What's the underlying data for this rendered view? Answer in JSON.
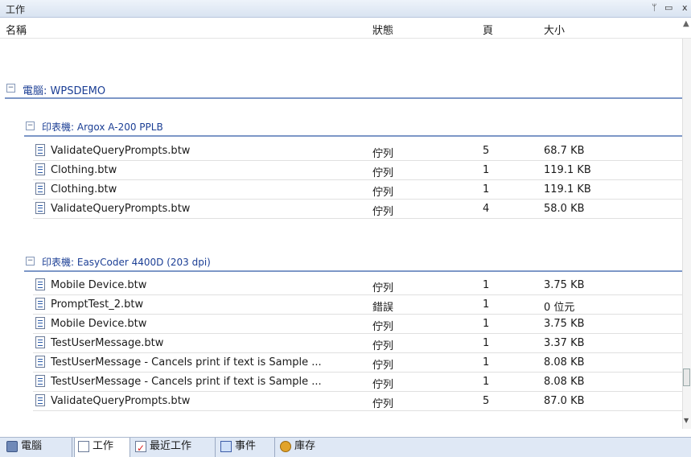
{
  "panel": {
    "title": "工作",
    "pin_glyph": "ᛘ",
    "restore_glyph": "▭",
    "close_glyph": "x"
  },
  "columns": {
    "name": "名稱",
    "status": "狀態",
    "pages": "頁",
    "size": "大小"
  },
  "computer_group": {
    "label": "電腦: WPSDEMO",
    "toggle": "−"
  },
  "printers": [
    {
      "label": "印表機: Argox A-200 PPLB",
      "toggle": "−",
      "jobs": [
        {
          "name": "ValidateQueryPrompts.btw",
          "status": "佇列",
          "pages": "5",
          "size": "68.7 KB"
        },
        {
          "name": "Clothing.btw",
          "status": "佇列",
          "pages": "1",
          "size": "119.1 KB"
        },
        {
          "name": "Clothing.btw",
          "status": "佇列",
          "pages": "1",
          "size": "119.1 KB"
        },
        {
          "name": "ValidateQueryPrompts.btw",
          "status": "佇列",
          "pages": "4",
          "size": "58.0 KB"
        }
      ]
    },
    {
      "label": "印表機: EasyCoder 4400D (203 dpi)",
      "toggle": "−",
      "jobs": [
        {
          "name": "Mobile Device.btw",
          "status": "佇列",
          "pages": "1",
          "size": "3.75 KB"
        },
        {
          "name": "PromptTest_2.btw",
          "status": "錯誤",
          "pages": "1",
          "size": "0 位元"
        },
        {
          "name": "Mobile Device.btw",
          "status": "佇列",
          "pages": "1",
          "size": "3.75 KB"
        },
        {
          "name": "TestUserMessage.btw",
          "status": "佇列",
          "pages": "1",
          "size": "3.37 KB"
        },
        {
          "name": "TestUserMessage - Cancels print if text is Sample ...",
          "status": "佇列",
          "pages": "1",
          "size": "8.08 KB"
        },
        {
          "name": "TestUserMessage - Cancels print if text is Sample ...",
          "status": "佇列",
          "pages": "1",
          "size": "8.08 KB"
        },
        {
          "name": "ValidateQueryPrompts.btw",
          "status": "佇列",
          "pages": "5",
          "size": "87.0 KB"
        }
      ]
    }
  ],
  "bottom_tabs": [
    {
      "label": "電腦",
      "icon": "computer-icon"
    },
    {
      "label": "工作",
      "icon": "document-icon",
      "active": true
    },
    {
      "label": "最近工作",
      "icon": "recent-jobs-icon"
    },
    {
      "label": "事件",
      "icon": "events-icon"
    },
    {
      "label": "庫存",
      "icon": "inventory-icon"
    }
  ],
  "colors": {
    "group_text": "#1c3f95",
    "group_rule": "#7d97c7",
    "tab_bar": "#dfe8f5"
  }
}
